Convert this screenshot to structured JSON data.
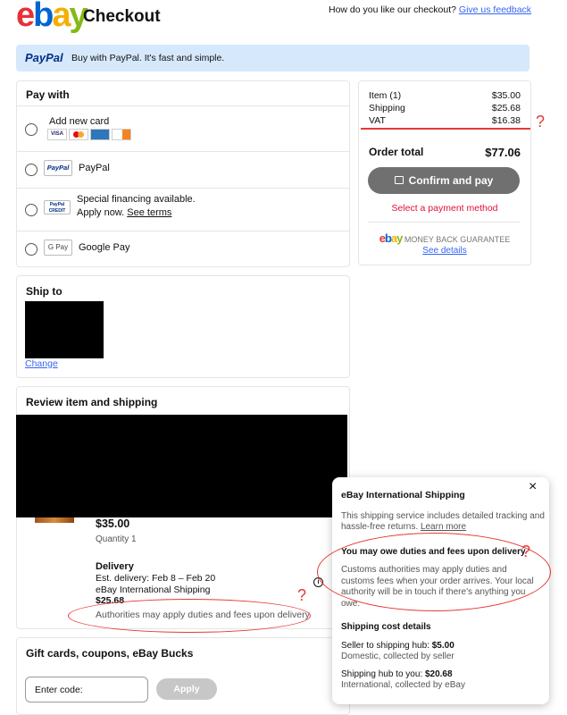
{
  "header": {
    "logo_letters": [
      "e",
      "b",
      "a",
      "y"
    ],
    "logo_colors": [
      "#e53238",
      "#0064d2",
      "#f5af02",
      "#86b817"
    ],
    "title": "Checkout",
    "feedback_prompt": "How do you like our checkout?",
    "feedback_link": "Give us feedback"
  },
  "paypal_banner": {
    "logo": "PayPal",
    "text": "Buy with PayPal. It's fast and simple."
  },
  "pay_with": {
    "title": "Pay with",
    "options": [
      {
        "label": "Add new card",
        "icon": "credit-cards-icon",
        "cards": [
          "VISA",
          "MC",
          "AMEX",
          "DISC"
        ]
      },
      {
        "label": "PayPal",
        "badge": "PayPal"
      },
      {
        "label": "Special financing available.",
        "sublabel": "Apply now.",
        "link": "See terms",
        "badge": "PayPal CREDIT"
      },
      {
        "label": "Google Pay",
        "badge": "G Pay"
      }
    ]
  },
  "summary": {
    "rows": [
      {
        "label": "Item (1)",
        "value": "$35.00"
      },
      {
        "label": "Shipping",
        "value": "$25.68"
      },
      {
        "label": "VAT",
        "value": "$16.38"
      }
    ],
    "total_label": "Order total",
    "total_value": "$77.06",
    "confirm_button": "Confirm and pay",
    "error_text": "Select a payment method",
    "guarantee": "MONEY BACK GUARANTEE",
    "see_details": "See details"
  },
  "ship_to": {
    "title": "Ship to",
    "change_link": "Change"
  },
  "review": {
    "title": "Review item and shipping",
    "price": "$35.00",
    "quantity": "Quantity 1",
    "delivery_title": "Delivery",
    "est_delivery": "Est. delivery: Feb 8 – Feb 20",
    "service": "eBay International Shipping",
    "shipping_cost": "$25.68",
    "duties_note": "Authorities may apply duties and fees upon delivery"
  },
  "gift": {
    "title": "Gift cards, coupons, eBay Bucks",
    "placeholder": "Enter code:",
    "apply_button": "Apply"
  },
  "popover": {
    "title": "eBay International Shipping",
    "intro": "This shipping service includes detailed tracking and hassle-free returns.",
    "learn_more": "Learn more",
    "duties_title": "You may owe duties and fees upon delivery",
    "duties_text": "Customs authorities may apply duties and customs fees when your order arrives. Your local authority will be in touch if there's anything you owe.",
    "cost_title": "Shipping cost details",
    "hub_label": "Seller to shipping hub:",
    "hub_value": "$5.00",
    "hub_note": "Domestic, collected by seller",
    "you_label": "Shipping hub to you:",
    "you_value": "$20.68",
    "you_note": "International, collected by eBay",
    "close": "×"
  },
  "annotations": {
    "question_mark": "?"
  },
  "colors": {
    "accent": "#3665f3",
    "error": "#e0103a",
    "banner": "#d6e8fb",
    "button_disabled": "#c7c7c7"
  }
}
